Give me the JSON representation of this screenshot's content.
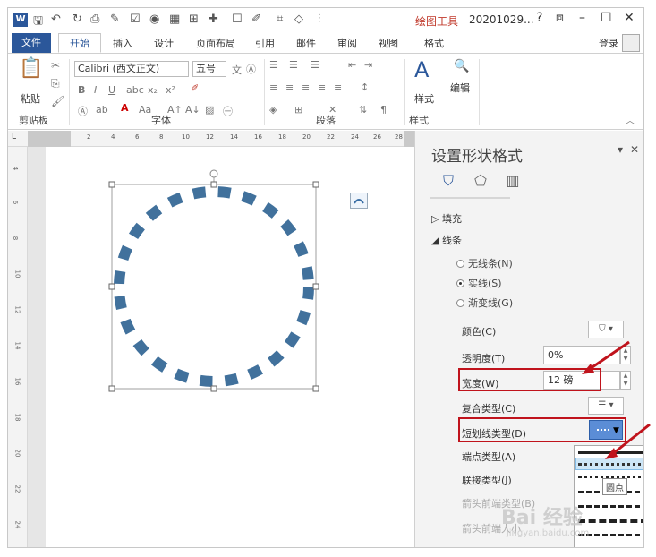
{
  "titlebar": {
    "contextual_tool": "绘图工具",
    "document_title": "20201029...",
    "help": "?",
    "restore": "⧈",
    "minimize": "–",
    "maximize": "☐",
    "close": "✕"
  },
  "tabs": {
    "file": "文件",
    "home": "开始",
    "insert": "插入",
    "design": "设计",
    "layout": "页面布局",
    "references": "引用",
    "mailings": "邮件",
    "review": "审阅",
    "view": "视图",
    "format": "格式",
    "login": "登录"
  },
  "ribbon": {
    "paste": "粘贴",
    "font_name": "Calibri (西文正文)",
    "font_size": "五号",
    "style": "样式",
    "edit": "编辑",
    "group_clipboard": "剪贴板",
    "group_font": "字体",
    "group_paragraph": "段落",
    "group_style": "样式"
  },
  "ruler": {
    "ticks": [
      "2",
      "4",
      "6",
      "8",
      "10",
      "12",
      "14",
      "16",
      "18",
      "20",
      "22",
      "24",
      "26",
      "28"
    ],
    "vticks": [
      "4",
      "6",
      "8",
      "10",
      "12",
      "14",
      "16",
      "18",
      "20",
      "22",
      "24"
    ]
  },
  "pane": {
    "title": "设置形状格式",
    "section_fill": "填充",
    "section_line": "线条",
    "opt_no_line": "无线条(N)",
    "opt_solid": "实线(S)",
    "opt_gradient": "渐变线(G)",
    "color_label": "颜色(C)",
    "transparency_label": "透明度(T)",
    "transparency_value": "0%",
    "width_label": "宽度(W)",
    "width_value": "12 磅",
    "compound_label": "复合类型(C)",
    "dash_label": "短划线类型(D)",
    "cap_label": "端点类型(A)",
    "join_label": "联接类型(J)",
    "arrow_begin_type": "箭头前端类型(B)",
    "arrow_begin_size": "箭头前端大小"
  },
  "popup": {
    "tooltip": "圆点"
  },
  "watermark": {
    "brand": "Bai 经验",
    "url": "jingyan.baidu.com"
  }
}
